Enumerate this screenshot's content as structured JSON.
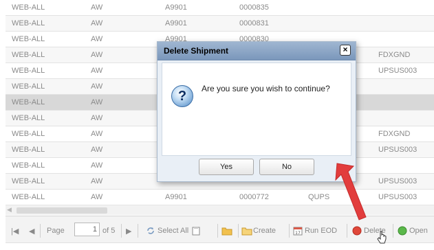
{
  "grid": {
    "rows": [
      {
        "c": [
          "WEB-ALL",
          "AW",
          "A9901",
          "0000835",
          "",
          ""
        ]
      },
      {
        "c": [
          "WEB-ALL",
          "AW",
          "A9901",
          "0000831",
          "",
          ""
        ]
      },
      {
        "c": [
          "WEB-ALL",
          "AW",
          "A9901",
          "0000830",
          "",
          ""
        ]
      },
      {
        "c": [
          "WEB-ALL",
          "AW",
          "",
          "",
          "",
          "FDXGND"
        ]
      },
      {
        "c": [
          "WEB-ALL",
          "AW",
          "",
          "",
          "",
          "UPSUS003"
        ]
      },
      {
        "c": [
          "WEB-ALL",
          "AW",
          "",
          "",
          "",
          ""
        ]
      },
      {
        "c": [
          "WEB-ALL",
          "AW",
          "",
          "",
          "",
          ""
        ],
        "selected": true
      },
      {
        "c": [
          "WEB-ALL",
          "AW",
          "",
          "",
          "",
          ""
        ]
      },
      {
        "c": [
          "WEB-ALL",
          "AW",
          "",
          "",
          "",
          "FDXGND"
        ]
      },
      {
        "c": [
          "WEB-ALL",
          "AW",
          "",
          "",
          "",
          "UPSUS003"
        ]
      },
      {
        "c": [
          "WEB-ALL",
          "AW",
          "",
          "",
          "",
          ""
        ]
      },
      {
        "c": [
          "WEB-ALL",
          "AW",
          "",
          "",
          "",
          "UPSUS003"
        ]
      },
      {
        "c": [
          "WEB-ALL",
          "AW",
          "A9901",
          "0000772",
          "QUPS",
          "UPSUS003"
        ]
      }
    ]
  },
  "toolbar": {
    "page_label": "Page",
    "page_value": "1",
    "of_label": "of 5",
    "select_all": "Select All",
    "create": "Create",
    "run_eod": "Run EOD",
    "delete": "Delete",
    "open": "Open",
    "colors": {
      "delete_icon": "#e0483a",
      "open_icon": "#5ab84a",
      "folder_icon": "#f2c14e"
    }
  },
  "dialog": {
    "title": "Delete Shipment",
    "message": "Are you sure you wish to continue?",
    "yes": "Yes",
    "no": "No",
    "close_glyph": "×",
    "icon": "question-icon"
  },
  "annotation": {
    "arrow_color": "#e23d3d"
  }
}
